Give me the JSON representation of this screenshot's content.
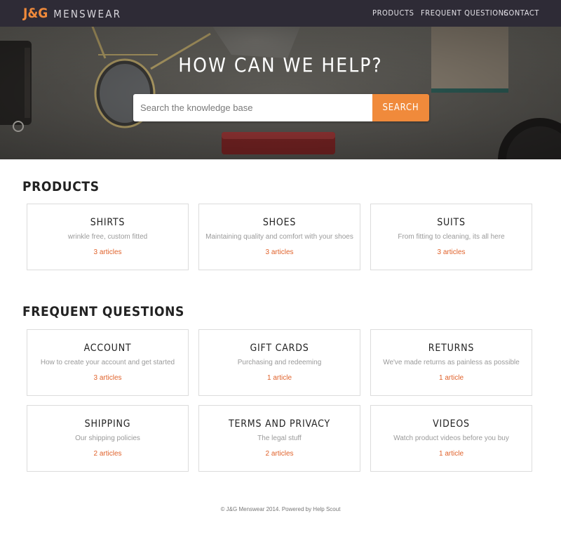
{
  "header": {
    "brand": "J&G",
    "brand_word": "MENSWEAR",
    "nav": [
      "PRODUCTS",
      "FREQUENT QUESTIONS",
      "CONTACT"
    ]
  },
  "hero": {
    "title": "HOW CAN WE HELP?",
    "search_placeholder": "Search the knowledge base",
    "search_button": "SEARCH"
  },
  "sections": [
    {
      "title": "PRODUCTS",
      "cards": [
        {
          "title": "SHIRTS",
          "desc": "wrinkle free, custom fitted",
          "count": "3 articles"
        },
        {
          "title": "SHOES",
          "desc": "Maintaining quality and comfort with your shoes",
          "count": "3 articles"
        },
        {
          "title": "SUITS",
          "desc": "From fitting to cleaning, its all here",
          "count": "3 articles"
        }
      ]
    },
    {
      "title": "FREQUENT QUESTIONS",
      "cards": [
        {
          "title": "ACCOUNT",
          "desc": "How to create your account and get started",
          "count": "3 articles"
        },
        {
          "title": "GIFT CARDS",
          "desc": "Purchasing and redeeming",
          "count": "1 article"
        },
        {
          "title": "RETURNS",
          "desc": "We've made returns as painless as possible",
          "count": "1 article"
        },
        {
          "title": "SHIPPING",
          "desc": "Our shipping policies",
          "count": "2 articles"
        },
        {
          "title": "TERMS AND PRIVACY",
          "desc": "The legal stuff",
          "count": "2 articles"
        },
        {
          "title": "VIDEOS",
          "desc": "Watch product videos before you buy",
          "count": "1 article"
        }
      ]
    }
  ],
  "footer": {
    "text": "© J&G Menswear 2014. Powered by Help Scout"
  },
  "colors": {
    "accent": "#f08a3b",
    "count_link": "#e0622b",
    "topbar": "#2e2b36"
  }
}
